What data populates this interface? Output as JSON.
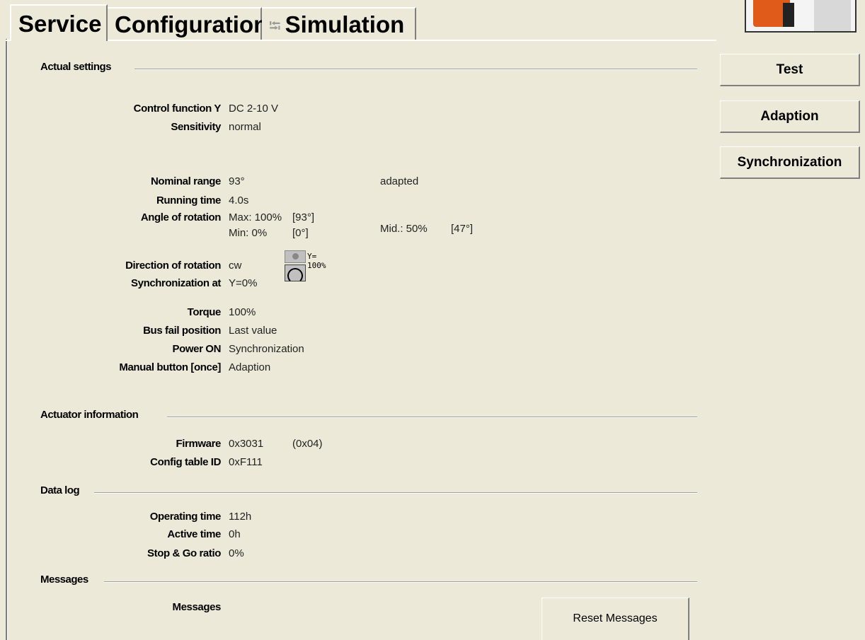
{
  "tabs": {
    "service": "Service",
    "configuration": "Configuration",
    "simulation": "Simulation"
  },
  "side_buttons": {
    "test": "Test",
    "adaption": "Adaption",
    "synchronization": "Synchronization"
  },
  "actual_settings": {
    "heading": "Actual settings",
    "control_function_label": "Control function Y",
    "control_function_value": "DC 2-10 V",
    "sensitivity_label": "Sensitivity",
    "sensitivity_value": "normal",
    "nominal_range_label": "Nominal range",
    "nominal_range_value": "93°",
    "nominal_range_status": "adapted",
    "running_time_label": "Running time",
    "running_time_value": "4.0s",
    "angle_label": "Angle of rotation",
    "angle_max": "Max: 100%",
    "angle_max_deg": "[93°]",
    "angle_min": "Min: 0%",
    "angle_min_deg": "[0°]",
    "angle_mid": "Mid.: 50%",
    "angle_mid_deg": "[47°]",
    "direction_label": "Direction of rotation",
    "direction_value": "cw",
    "direction_icon_line1": "Y=",
    "direction_icon_line2": "100%",
    "sync_label": "Synchronization at",
    "sync_value": "Y=0%",
    "torque_label": "Torque",
    "torque_value": "100%",
    "bus_fail_label": "Bus fail position",
    "bus_fail_value": "Last value",
    "power_on_label": "Power ON",
    "power_on_value": "Synchronization",
    "manual_label": "Manual button [once]",
    "manual_value": "Adaption"
  },
  "actuator_info": {
    "heading": "Actuator information",
    "firmware_label": "Firmware",
    "firmware_value": "0x3031",
    "firmware_extra": "(0x04)",
    "config_label": "Config table ID",
    "config_value": "0xF111"
  },
  "data_log": {
    "heading": "Data log",
    "operating_label": "Operating time",
    "operating_value": "112h",
    "active_label": "Active time",
    "active_value": "0h",
    "stopgo_label": "Stop & Go ratio",
    "stopgo_value": "0%"
  },
  "messages": {
    "heading": "Messages",
    "label": "Messages",
    "reset_button": "Reset Messages"
  }
}
